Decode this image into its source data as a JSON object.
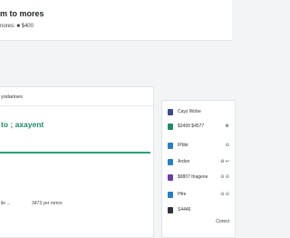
{
  "header": {
    "title": "m to mores",
    "subtitle": "nores: ■ $400"
  },
  "main": {
    "section_label": "yodarines",
    "title": "to ; axayent",
    "progress": 1.0,
    "progress_color": "#23a374",
    "footer_left": "ile ...",
    "footer_right": "3473  yer romrs"
  },
  "side": {
    "items": [
      {
        "label": "Cayz Wobe",
        "value": "",
        "icon": "card-icon",
        "icon_color": "#3b4a8a"
      },
      {
        "label": "$3499 $4577",
        "value": "⚙",
        "icon": "money-icon",
        "icon_color": "#1f8a6a"
      },
      {
        "label": "IPbbr",
        "value": "⊙",
        "icon": "chart-icon",
        "icon_color": "#2a7fbf"
      },
      {
        "label": "Ardon",
        "value": "⊖ ↩",
        "icon": "person-icon",
        "icon_color": "#2a7fbf"
      },
      {
        "label": "$9807 thagene",
        "value": "⊙ ⊙",
        "icon": "document-icon",
        "icon_color": "#6a3fa0"
      },
      {
        "label": "Hfre",
        "value": "⊙ ⊙",
        "icon": "people-icon",
        "icon_color": "#2a7fbf"
      },
      {
        "label": "S4446",
        "value": "",
        "icon": "wallet-icon",
        "icon_color": "#2f3338"
      }
    ],
    "footer": "Corect"
  }
}
